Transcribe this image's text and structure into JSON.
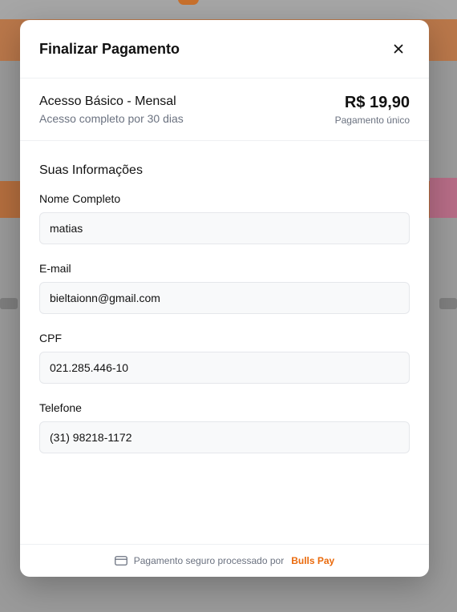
{
  "modal": {
    "title": "Finalizar Pagamento",
    "close_icon": "close-icon"
  },
  "plan": {
    "name": "Acesso Básico - Mensal",
    "description": "Acesso completo por 30 dias",
    "price": "R$ 19,90",
    "price_note": "Pagamento único"
  },
  "form": {
    "section_title": "Suas Informações",
    "fields": [
      {
        "label": "Nome Completo",
        "value": "matias"
      },
      {
        "label": "E-mail",
        "value": "bieltaionn@gmail.com"
      },
      {
        "label": "CPF",
        "value": "021.285.446-10"
      },
      {
        "label": "Telefone",
        "value": "(31) 98218-1172"
      }
    ]
  },
  "footer": {
    "text": "Pagamento seguro processado por",
    "brand": "Bulls Pay",
    "brand_color": "#ea6a0c",
    "icon": "credit-card-icon"
  }
}
